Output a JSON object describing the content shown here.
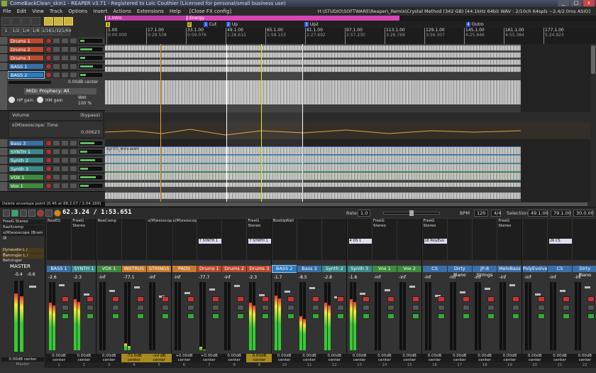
{
  "titlebar": {
    "title": "ComeBackClean_skin1 - REAPER v3.71 - Registered to Loic Couthier (Licensed for personal/small business use)"
  },
  "window_buttons": [
    "_",
    "□",
    "x"
  ],
  "menu": {
    "items": [
      "File",
      "Edit",
      "View",
      "Track",
      "Options",
      "Insert",
      "Actions",
      "Extensions",
      "Help"
    ],
    "fx_config": "[Close FX config]",
    "path": "H:\\STUDIO\\SOFTWARE\\Reaper\\_Remix\\Crystal Method (342 GB) [44.1kHz 64bit WAV : 2/10ch 64spls ~2.4/2.0ms ASIO]"
  },
  "toolbar": {
    "row2": [
      "1",
      "1/2",
      "1/4",
      "1/8",
      "1/16",
      "1/32",
      "1/64"
    ]
  },
  "regions": [
    {
      "label": "1.Intro",
      "color": "#c03aa8"
    },
    {
      "label": "Energy",
      "color": "#d845b8"
    }
  ],
  "markers": [
    {
      "num": "1",
      "label": "",
      "yellow": true
    },
    {
      "num": "2",
      "label": "",
      "yellow": true
    },
    {
      "num": "1",
      "label": "Cut",
      "yellow": false
    },
    {
      "num": "2",
      "label": "Up",
      "yellow": false
    },
    {
      "num": "3",
      "label": "Up2",
      "yellow": false
    },
    {
      "num": "4",
      "label": "Outro",
      "yellow": false
    }
  ],
  "ruler": [
    {
      "bar": "1.00",
      "time": "0:00.000"
    },
    {
      "bar": "17.1.00",
      "time": "0:29.538"
    },
    {
      "bar": "33.1.00",
      "time": "0:59.076"
    },
    {
      "bar": "49.1.00",
      "time": "1:28.615"
    },
    {
      "bar": "65.1.00",
      "time": "1:58.153"
    },
    {
      "bar": "81.1.00",
      "time": "2:27.692"
    },
    {
      "bar": "97.1.00",
      "time": "2:57.230"
    },
    {
      "bar": "113.1.00",
      "time": "3:26.769"
    },
    {
      "bar": "129.1.00",
      "time": "3:56.307"
    },
    {
      "bar": "145.1.00",
      "time": "4:25.846"
    },
    {
      "bar": "161.1.00",
      "time": "4:55.384"
    },
    {
      "bar": "177.1.00",
      "time": "5:24.923"
    }
  ],
  "tracks": [
    {
      "name": "Drums 1",
      "color": "red"
    },
    {
      "name": "Drums 2",
      "color": "red"
    },
    {
      "name": "Drums 3",
      "color": "red"
    },
    {
      "name": "BASS 1",
      "color": "blue"
    },
    {
      "name": "BASS 2",
      "color": "sel"
    },
    {
      "name": "Bass 3",
      "color": "blue"
    },
    {
      "name": "SYNTH 1",
      "color": "teal"
    },
    {
      "name": "Synth 2",
      "color": "teal"
    },
    {
      "name": "Synth 3",
      "color": "teal"
    },
    {
      "name": "VOX 1",
      "color": "green"
    },
    {
      "name": "Vox 1",
      "color": "green"
    }
  ],
  "bass2": {
    "vol": "0.00dB center",
    "fx": "MIDI: Prophecy: All",
    "hp": "HP gain",
    "hm": "HM gain",
    "wet": "Wet",
    "wet_val": "100 %"
  },
  "envelopes": {
    "volume": "Volume",
    "bypass": "(bypass)",
    "jsfx": "s(M)exoscope: Time",
    "jsfx_val": "0.00623"
  },
  "items": {
    "bass": "bass_wav.wav",
    "synth": "synth_wav.wav"
  },
  "status": "Delete envelope point [0.46 at 88.2.07 / 2:04.189]",
  "transport": {
    "position": "62.3.24 / 1:53.651",
    "rate_label": "Rate:",
    "rate": "1.0",
    "bpm_label": "BPM",
    "bpm": "120",
    "sig": "4/4",
    "selection_label": "Selection:",
    "sel_start": "49.1.00",
    "sel_end": "79.1.00",
    "sel_len": "30.0.00"
  },
  "master": {
    "fx": [
      "FreeG Stereo",
      "RazXcomp",
      "s(M)exoscope (Bram @"
    ],
    "label": "MASTER",
    "vol_l": "-0.4",
    "vol_r": "-0.6",
    "plugin1": "Dynaudio L / Dynaudio",
    "plugin2": "Behringer L / Behringer",
    "pan": "0.00dB center",
    "footer": "Master"
  },
  "strips": [
    {
      "name": "BASS 1",
      "color": "blue",
      "fx": "ReaEQ",
      "slot": "",
      "vol": "-2.6",
      "pan": "0.00dB center",
      "num": "1",
      "lvl": 0.7
    },
    {
      "name": "SYNTH 1",
      "color": "teal",
      "fx": "FreeG Stereo",
      "slot": "",
      "vol": "-2.3",
      "pan": "0.00dB center",
      "num": "2",
      "lvl": 0.75
    },
    {
      "name": "VOX 1",
      "color": "green",
      "fx": "ReaComp",
      "slot": "",
      "vol": "-inf",
      "pan": "0.00dB center",
      "num": "3",
      "lvl": 0.0
    },
    {
      "name": "INSTRUS",
      "color": "orange",
      "fx": "",
      "slot": "",
      "vol": "-77.1",
      "pan": "-72.0dB center",
      "num": "4",
      "lvl": 0.1,
      "ypan": true
    },
    {
      "name": "STRINGS",
      "color": "orange",
      "fx": "s(M)exoscope",
      "slot": "",
      "vol": "-inf",
      "pan": "-inf dB center",
      "num": "5",
      "lvl": 0.0,
      "ypan": true
    },
    {
      "name": "PADS",
      "color": "orange",
      "fx": "s(M)exoscope",
      "slot": "",
      "vol": "-inf",
      "pan": "+0.00dB center",
      "num": "6",
      "lvl": 0.0
    },
    {
      "name": "Drums 1",
      "color": "red",
      "fx": "",
      "slot": "7 SYNTH 1",
      "vol": "-77.7",
      "pan": "+0.00dB center",
      "num": "7",
      "lvl": 0.05
    },
    {
      "name": "Drums 2",
      "color": "red",
      "fx": "",
      "slot": "",
      "vol": "-inf",
      "pan": "0.00dB center",
      "num": "8",
      "lvl": 0.0
    },
    {
      "name": "Drums 3",
      "color": "red",
      "fx": "FreeG Stereo",
      "slot": "7 SYNTH 1",
      "vol": "-2.3",
      "pan": "0.00dB center",
      "num": "9",
      "lvl": 0.7,
      "ypan": true
    },
    {
      "name": "BASS 2",
      "color": "sel",
      "fx": "BootiqWall",
      "slot": "",
      "vol": "-1.7",
      "pan": "0.00dB center",
      "num": "10",
      "lvl": 0.8
    },
    {
      "name": "Bass 3",
      "color": "blue",
      "fx": "",
      "slot": "",
      "vol": "-8.5",
      "pan": "0.00dB center",
      "num": "11",
      "lvl": 0.5
    },
    {
      "name": "Synth 2",
      "color": "teal",
      "fx": "",
      "slot": "",
      "vol": "-2.8",
      "pan": "0.00dB center",
      "num": "12",
      "lvl": 0.7
    },
    {
      "name": "Synth 3",
      "color": "teal",
      "fx": "",
      "slot": "4 DS 1",
      "vol": "-1.6",
      "pan": "0.00dB center",
      "num": "13",
      "lvl": 0.75
    },
    {
      "name": "Vox 1",
      "color": "green",
      "fx": "FreeG Stereo",
      "slot": "",
      "vol": "-inf",
      "pan": "0.00dB center",
      "num": "14",
      "lvl": 0.0
    },
    {
      "name": "Vox 2",
      "color": "green",
      "fx": "",
      "slot": "",
      "vol": "-inf",
      "pan": "0.00dB center",
      "num": "15",
      "lvl": 0.0
    },
    {
      "name": "CS",
      "color": "blue",
      "fx": "FreeG Stereo",
      "slot": "18 PolyEvo",
      "vol": "-inf",
      "pan": "0.00dB center",
      "num": "16",
      "lvl": 0.0
    },
    {
      "name": "Dirty Piano",
      "color": "blue",
      "fx": "",
      "slot": "",
      "vol": "-inf",
      "pan": "0.00dB center",
      "num": "17",
      "lvl": 0.0
    },
    {
      "name": "JP-8 Strings",
      "color": "blue",
      "fx": "",
      "slot": "",
      "vol": "-inf",
      "pan": "0.00dB center",
      "num": "18",
      "lvl": 0.0
    },
    {
      "name": "MeloBass",
      "color": "blue",
      "fx": "FreeG Stereo",
      "slot": "",
      "vol": "-inf",
      "pan": "0.00dB center",
      "num": "19",
      "lvl": 0.0
    },
    {
      "name": "PolyEvolver",
      "color": "blue",
      "fx": "",
      "slot": "",
      "vol": "-inf",
      "pan": "0.00dB center",
      "num": "20",
      "lvl": 0.0
    },
    {
      "name": "CS",
      "color": "blue",
      "fx": "",
      "slot": "26 CS",
      "vol": "-inf",
      "pan": "0.00dB center",
      "num": "21",
      "lvl": 0.0
    },
    {
      "name": "Dirty Piano",
      "color": "blue",
      "fx": "",
      "slot": "",
      "vol": "-inf",
      "pan": "0.00dB center",
      "num": "22",
      "lvl": 0.0
    }
  ]
}
